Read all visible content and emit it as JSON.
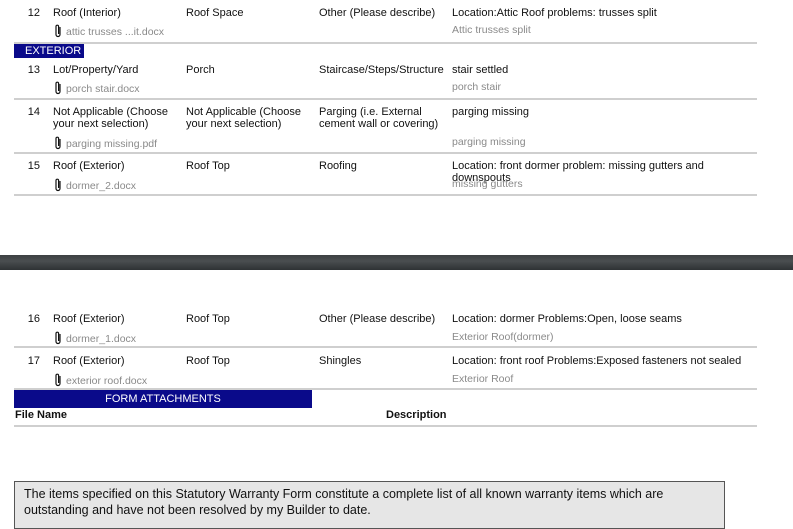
{
  "rows_top": [
    {
      "num": "12",
      "item": "Roof (Interior)",
      "location": "Roof Space",
      "category": "Other (Please describe)",
      "detail": "Location:Attic Roof problems: trusses split",
      "attachment": "attic trusses ...it.docx",
      "attachment_desc": "Attic trusses split"
    },
    {
      "num": "13",
      "item": "Lot/Property/Yard",
      "location": "Porch",
      "category": "Staircase/Steps/Structure",
      "detail": "stair settled",
      "attachment": "porch stair.docx",
      "attachment_desc": "porch stair"
    },
    {
      "num": "14",
      "item": "Not Applicable (Choose your next selection)",
      "location": "Not Applicable (Choose your next selection)",
      "category": "Parging (i.e. External cement wall or covering)",
      "detail": "parging missing",
      "attachment": "parging missing.pdf",
      "attachment_desc": "parging missing"
    },
    {
      "num": "15",
      "item": "Roof (Exterior)",
      "location": "Roof Top",
      "category": "Roofing",
      "detail": "Location: front dormer problem: missing gutters and downspouts",
      "attachment": "dormer_2.docx",
      "attachment_desc": "missing gutters"
    }
  ],
  "section_exterior": "EXTERIOR",
  "rows_bottom": [
    {
      "num": "16",
      "item": "Roof (Exterior)",
      "location": "Roof Top",
      "category": "Other (Please describe)",
      "detail": "Location: dormer Problems:Open, loose seams",
      "attachment": "dormer_1.docx",
      "attachment_desc": "Exterior Roof(dormer)"
    },
    {
      "num": "17",
      "item": "Roof (Exterior)",
      "location": "Roof Top",
      "category": "Shingles",
      "detail": "Location: front roof Problems:Exposed fasteners not sealed",
      "attachment": "exterior roof.docx",
      "attachment_desc": "Exterior Roof"
    }
  ],
  "form_attachments": {
    "title": "FORM ATTACHMENTS",
    "file_name_header": "File Name",
    "description_header": "Description"
  },
  "notice": "The items specified on this Statutory Warranty Form constitute a complete list of all known warranty items which are outstanding and have not been resolved by my Builder to date."
}
